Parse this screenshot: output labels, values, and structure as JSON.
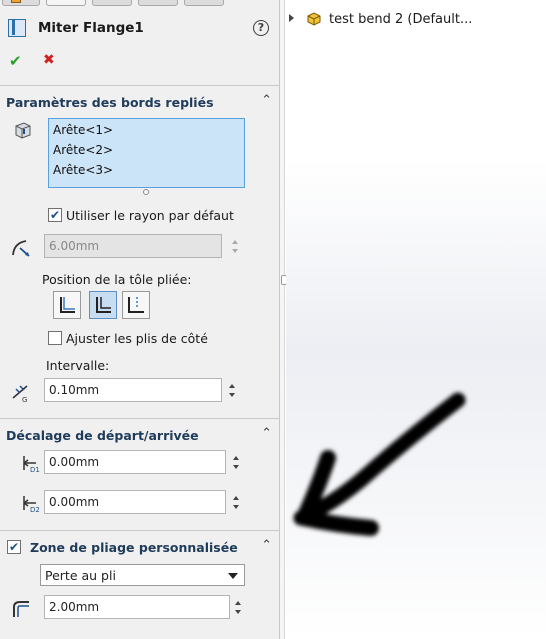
{
  "panel": {
    "title": "Miter Flange1",
    "help_glyph": "?",
    "ok_glyph": "✔",
    "cancel_glyph": "✖",
    "icons": {
      "title": "miter-flange-icon",
      "ok": "check-icon",
      "cancel": "close-icon",
      "help": "help-icon"
    }
  },
  "section_flange": {
    "title": "Paramètres des bords repliés",
    "collapse_glyph": "⌃",
    "edges": [
      "Arête<1>",
      "Arête<2>",
      "Arête<3>"
    ],
    "use_default_radius": {
      "checked": true,
      "label": "Utiliser le rayon par défaut",
      "mark": "✔"
    },
    "radius": {
      "value": "6.00mm",
      "disabled": true
    },
    "position_label": "Position de la tôle pliée:",
    "position_options": [
      "material-inside-icon",
      "material-outside-icon",
      "bend-outside-icon"
    ],
    "position_selected": 1,
    "trim_side_bends": {
      "checked": false,
      "label": "Ajuster les plis de côté"
    },
    "gap_label": "Intervalle:",
    "gap": {
      "value": "0.10mm"
    }
  },
  "section_offset": {
    "title": "Décalage de départ/arrivée",
    "collapse_glyph": "⌃",
    "start_offset": {
      "value": "0.00mm",
      "icon_label": "D1"
    },
    "end_offset": {
      "value": "0.00mm",
      "icon_label": "D2"
    }
  },
  "section_custom_relief": {
    "title": "Zone de pliage personnalisée",
    "checked": true,
    "mark": "✔",
    "collapse_glyph": "⌃",
    "relief_type": "Perte au pli",
    "value": "2.00mm"
  },
  "graphics": {
    "tree_item": "test bend 2  (Default..."
  },
  "colors": {
    "panel_bg": "#f0f0f0",
    "selection_bg": "#cce4f7",
    "selection_border": "#5aa0dc",
    "section_title": "#1f3b5a",
    "ok": "#2a9d2a",
    "cancel": "#d02020"
  }
}
